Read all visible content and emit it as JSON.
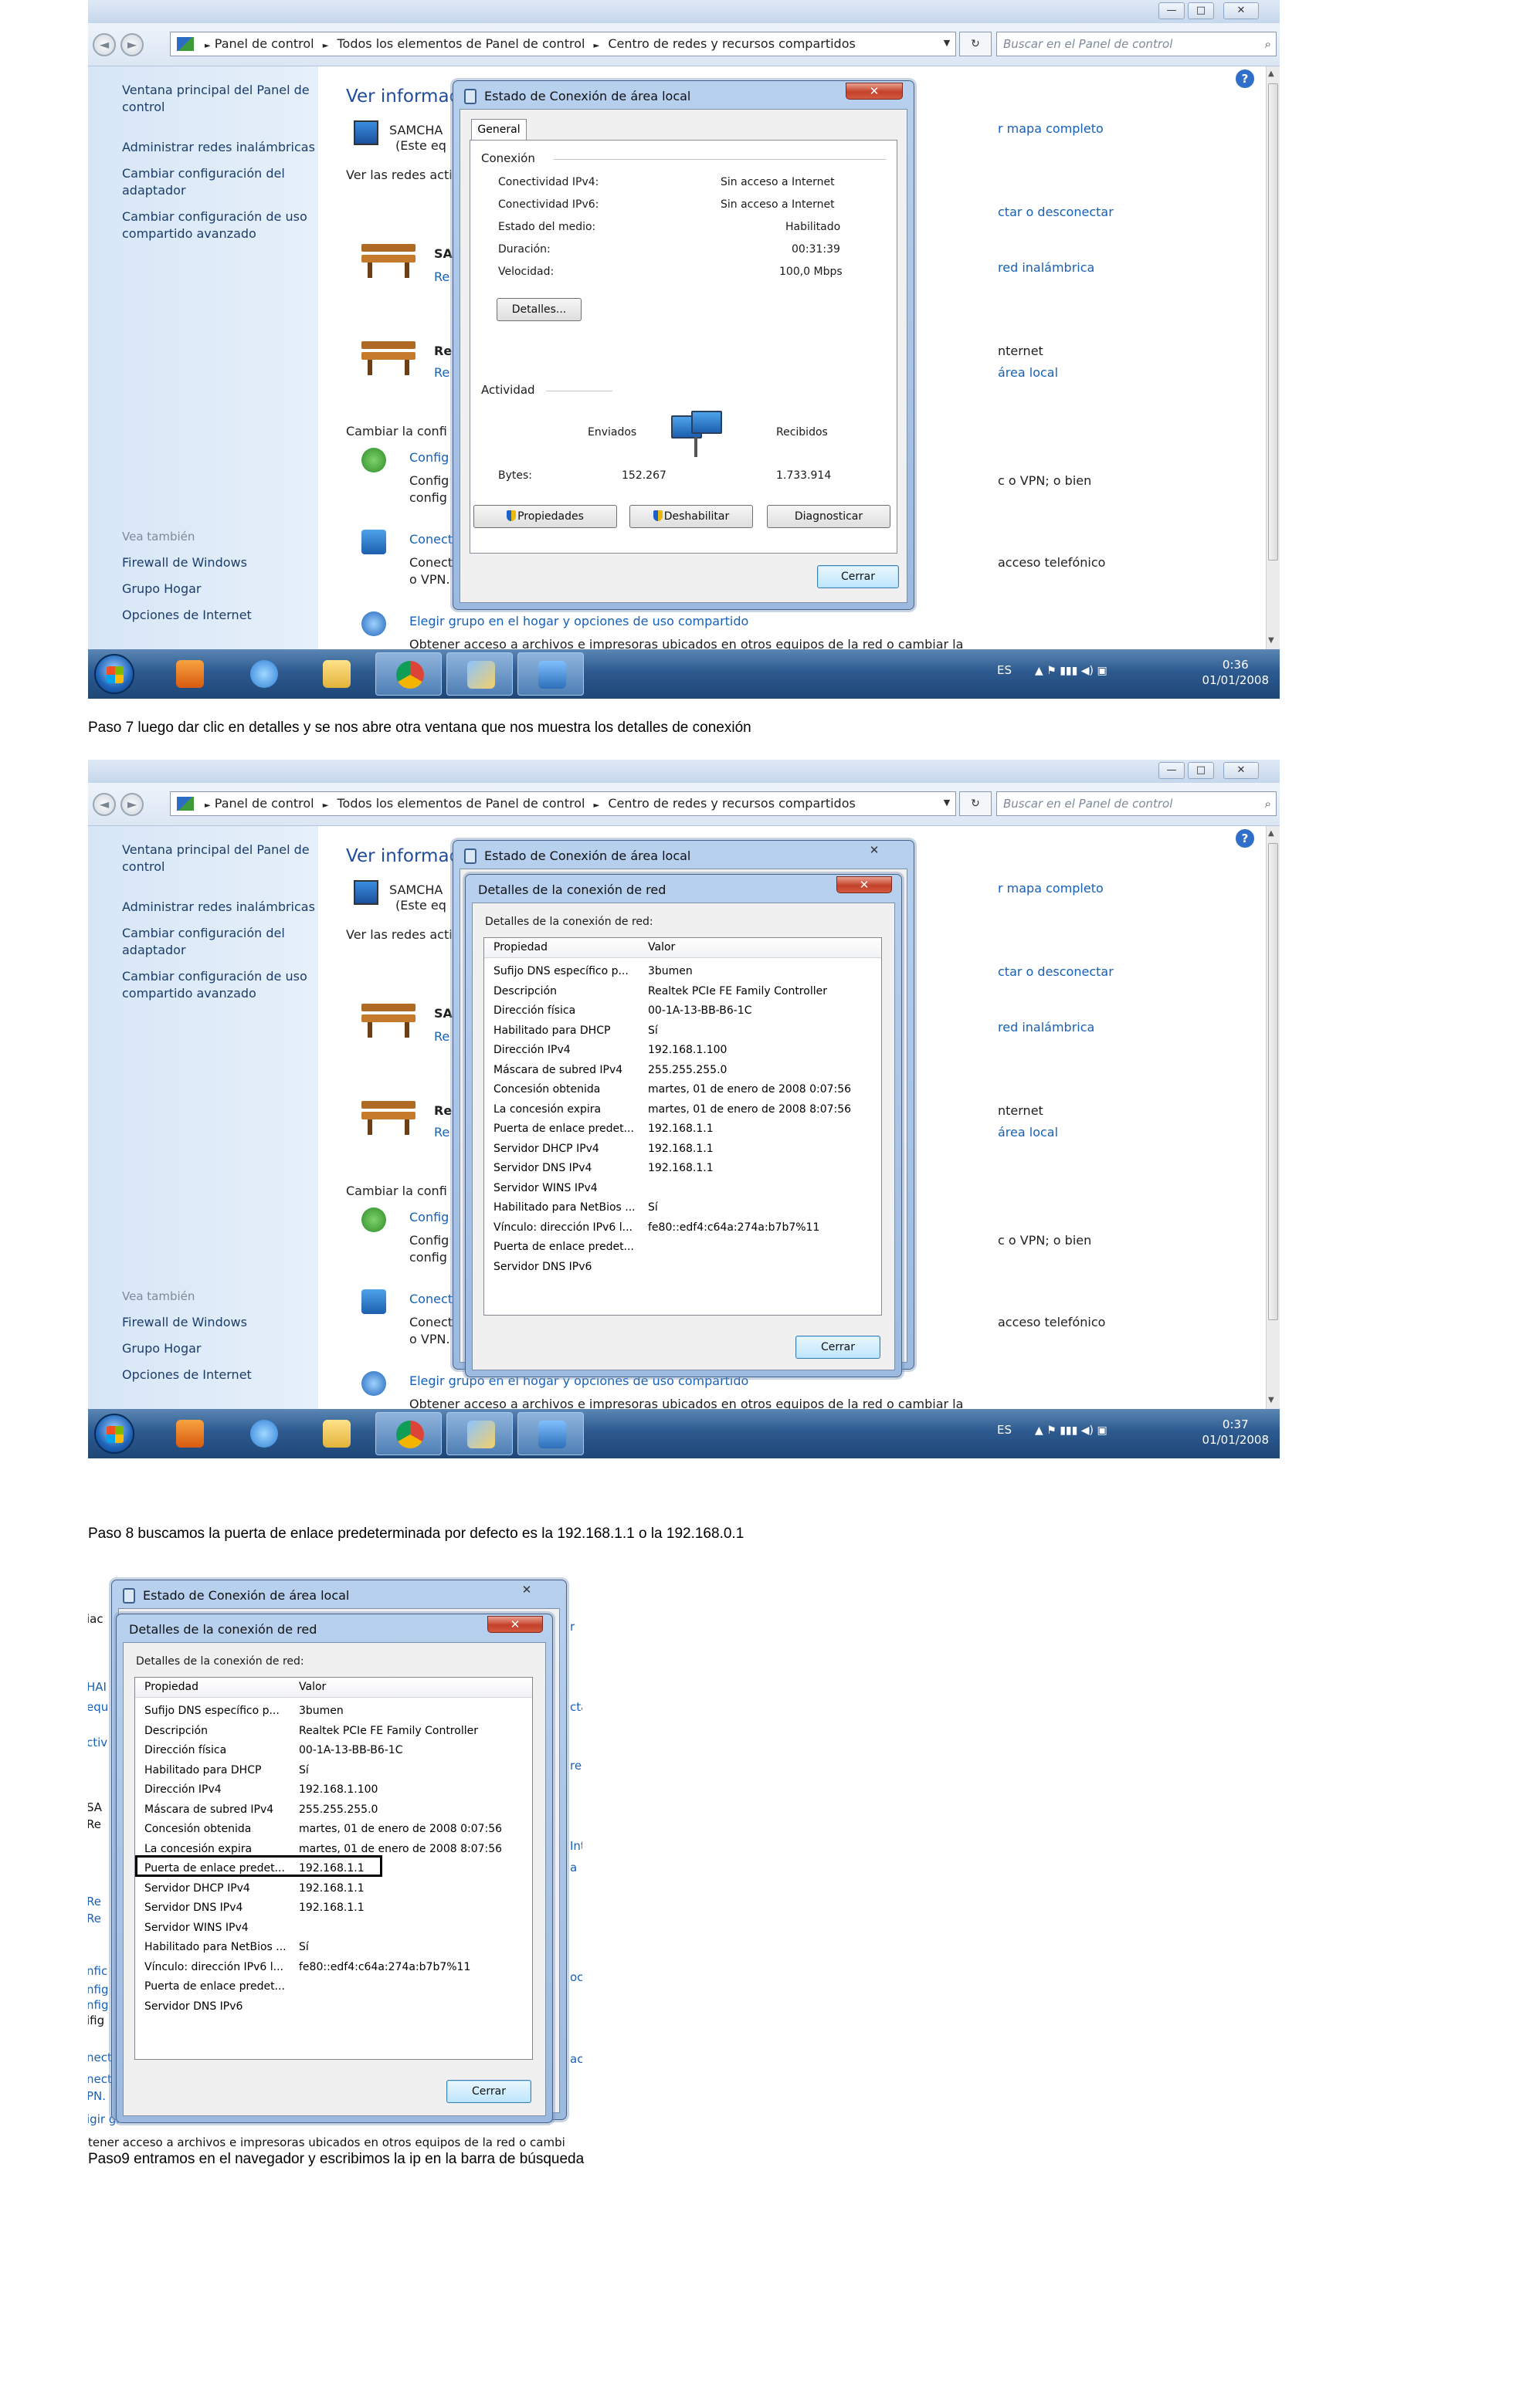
{
  "window": {
    "minimize": "—",
    "maximize": "□",
    "close": "✕",
    "back": "◄",
    "forward": "►",
    "breadcrumb": [
      "Panel de control",
      "Todos los elementos de Panel de control",
      "Centro de redes y recursos compartidos"
    ],
    "breadcrumb_sep": "►",
    "dropdown": "▼",
    "refresh": "↻",
    "search_placeholder": "Buscar en el Panel de control",
    "search_icon": "⌕",
    "help": "?",
    "scroll_up": "▲",
    "scroll_down": "▼"
  },
  "sidebar": {
    "links": [
      "Ventana principal del Panel de control",
      "Administrar redes inalámbricas",
      "Cambiar configuración del adaptador",
      "Cambiar configuración de uso compartido avanzado"
    ],
    "see_also_heading": "Vea también",
    "see_also": [
      "Firewall de Windows",
      "Grupo Hogar",
      "Opciones de Internet"
    ]
  },
  "main": {
    "heading_partial": "Ver informac",
    "computer_partial": "SAMCHA",
    "computer_sub_partial": "(Este eq",
    "active_nets_partial": "Ver las redes activ",
    "net1_partial": "SA",
    "net1_sub_partial": "Re",
    "net2_partial": "Re",
    "net2_sub_partial": "Re",
    "change_partial": "Cambiar la confi",
    "setup_partial": "Config",
    "setup_desc1": "Config",
    "setup_desc2": "config",
    "connect_partial": "Conect",
    "connect_desc1": "Conect",
    "connect_desc2": "o VPN.",
    "homegroup_link": "Elegir grupo en el hogar y opciones de uso compartido",
    "homegroup_desc": "Obtener acceso a archivos e impresoras ubicados en otros equipos de la red o cambiar la",
    "right_map": "r mapa completo",
    "right_disconnect": "ctar o desconectar",
    "right_wifi": "red inalámbrica",
    "right_internet": "nternet",
    "right_lan": "área local",
    "right_vpn": "c o VPN; o bien",
    "right_dialup": "acceso telefónico"
  },
  "taskbar": {
    "lang": "ES",
    "tray_icons": "▲  ⚑  ▮▮▮  ◀)  ▣",
    "time1": "0:36",
    "time2": "0:37",
    "date": "01/01/2008"
  },
  "status_dialog": {
    "title": "Estado de Conexión de área local",
    "tab": "General",
    "connection_label": "Conexión",
    "rows": [
      {
        "k": "Conectividad IPv4:",
        "v": "Sin acceso a Internet"
      },
      {
        "k": "Conectividad IPv6:",
        "v": "Sin acceso a Internet"
      },
      {
        "k": "Estado del medio:",
        "v": "Habilitado"
      },
      {
        "k": "Duración:",
        "v": "00:31:39"
      },
      {
        "k": "Velocidad:",
        "v": "100,0 Mbps"
      }
    ],
    "details_button": "Detalles...",
    "activity_label": "Actividad",
    "sent_label": "Enviados",
    "received_label": "Recibidos",
    "bytes_label": "Bytes:",
    "bytes_sent": "152.267",
    "bytes_received": "1.733.914",
    "properties_button": "Propiedades",
    "disable_button": "Deshabilitar",
    "diagnose_button": "Diagnosticar",
    "close_button": "Cerrar"
  },
  "details_dialog": {
    "title": "Detalles de la conexión de red",
    "label": "Detalles de la conexión de red:",
    "col_property": "Propiedad",
    "col_value": "Valor",
    "rows": [
      {
        "p": "Sufijo DNS específico p...",
        "v": "3bumen"
      },
      {
        "p": "Descripción",
        "v": "Realtek PCIe FE Family Controller"
      },
      {
        "p": "Dirección física",
        "v": "00-1A-13-BB-B6-1C"
      },
      {
        "p": "Habilitado para DHCP",
        "v": "Sí"
      },
      {
        "p": "Dirección IPv4",
        "v": "192.168.1.100"
      },
      {
        "p": "Máscara de subred IPv4",
        "v": "255.255.255.0"
      },
      {
        "p": "Concesión obtenida",
        "v": "martes, 01 de enero de 2008 0:07:56"
      },
      {
        "p": "La concesión expira",
        "v": "martes, 01 de enero de 2008 8:07:56"
      },
      {
        "p": "Puerta de enlace predet...",
        "v": "192.168.1.1"
      },
      {
        "p": "Servidor DHCP IPv4",
        "v": "192.168.1.1"
      },
      {
        "p": "Servidor DNS IPv4",
        "v": "192.168.1.1"
      },
      {
        "p": "Servidor WINS IPv4",
        "v": ""
      },
      {
        "p": "Habilitado para NetBios ...",
        "v": "Sí"
      },
      {
        "p": "Vínculo: dirección IPv6 l...",
        "v": "fe80::edf4:c64a:274a:b7b7%11"
      },
      {
        "p": "Puerta de enlace predet...",
        "v": ""
      },
      {
        "p": "Servidor DNS IPv6",
        "v": ""
      }
    ],
    "close_button": "Cerrar"
  },
  "crop_edges": {
    "left": [
      "iac",
      "HAI",
      "equ",
      "ctiv",
      "SA",
      "Re",
      "Re",
      "Re",
      "nfic",
      "nfig",
      "nfig",
      "ifig",
      "nect",
      "nect",
      "PN.",
      "igir gr"
    ],
    "right": [
      "r",
      "cta",
      "re",
      "Int",
      "a",
      "oc",
      "ac"
    ],
    "bottom": "tener acceso a archivos e impresoras ubicados en otros equipos de la red o cambi"
  },
  "paragraphs": {
    "p7": "Paso 7 luego dar clic en detalles y se nos abre otra ventana que nos muestra los detalles de conexión",
    "p8": "Paso 8 buscamos la puerta de enlace predeterminada por defecto es la 192.168.1.1 o la 192.168.0.1",
    "p9": "Paso9 entramos en el navegador y escribimos la ip en la barra de búsqueda"
  }
}
